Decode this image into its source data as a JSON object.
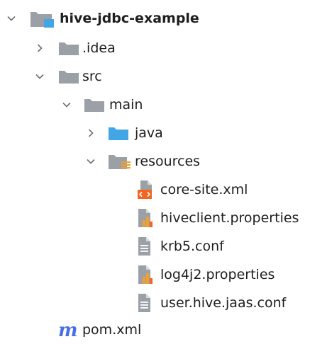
{
  "tree": {
    "root": {
      "label": "hive-jdbc-example"
    },
    "idea": {
      "label": ".idea"
    },
    "src": {
      "label": "src"
    },
    "main": {
      "label": "main"
    },
    "java": {
      "label": "java"
    },
    "resources": {
      "label": "resources"
    },
    "files": {
      "core_site": {
        "label": "core-site.xml"
      },
      "hiveclient": {
        "label": "hiveclient.properties"
      },
      "krb5": {
        "label": "krb5.conf"
      },
      "log4j2": {
        "label": "log4j2.properties"
      },
      "jaas": {
        "label": "user.hive.jaas.conf"
      }
    },
    "pom": {
      "label": "pom.xml",
      "icon_letter": "m"
    }
  },
  "colors": {
    "folder_gray": "#9aa0a6",
    "folder_blue": "#40a6e6",
    "arrow": "#6e6e6e",
    "xml_orange": "#f26522",
    "chart_orange": "#f0a030",
    "maven_blue": "#4a6fe3"
  },
  "icons": {
    "expanded": "chevron-down-icon",
    "collapsed": "chevron-right-icon",
    "module_folder": "module-folder-icon",
    "folder": "folder-icon",
    "source_folder": "source-folder-icon",
    "resources_folder": "resources-folder-icon",
    "xml_file": "xml-file-icon",
    "properties_file": "properties-file-icon",
    "text_file": "text-file-icon",
    "maven": "maven-icon"
  }
}
